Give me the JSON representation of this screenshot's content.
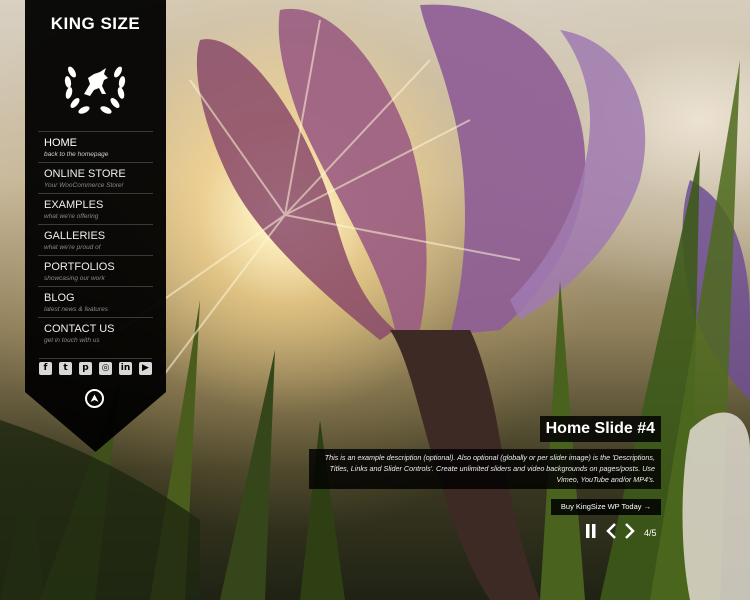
{
  "site": {
    "title": "KING SIZE"
  },
  "menu": [
    {
      "label": "HOME",
      "sub": "back to the homepage",
      "active": true
    },
    {
      "label": "ONLINE STORE",
      "sub": "Your WooCommerce Store!"
    },
    {
      "label": "EXAMPLES",
      "sub": "what we're offering"
    },
    {
      "label": "GALLERIES",
      "sub": "what we're proud of"
    },
    {
      "label": "PORTFOLIOS",
      "sub": "showcasing our work"
    },
    {
      "label": "BLOG",
      "sub": "latest news & features"
    },
    {
      "label": "CONTACT US",
      "sub": "get in touch with us"
    }
  ],
  "social_icons": [
    "facebook-icon",
    "twitter-icon",
    "pinterest-icon",
    "instagram-icon",
    "linkedin-icon",
    "youtube-icon"
  ],
  "slide": {
    "title": "Home Slide #4",
    "description": "This is an example description (optional). Also optional (globally or per slider image) is the 'Descriptions, Titles, Links and Slider Controls'. Create unlimited sliders and video backgrounds on pages/posts. Use Vimeo, YouTube and/or MP4's.",
    "button": "Buy KingSize WP Today →",
    "counter": "4/5"
  },
  "colors": {
    "sidebar": "#000000",
    "text": "#ffffff"
  }
}
